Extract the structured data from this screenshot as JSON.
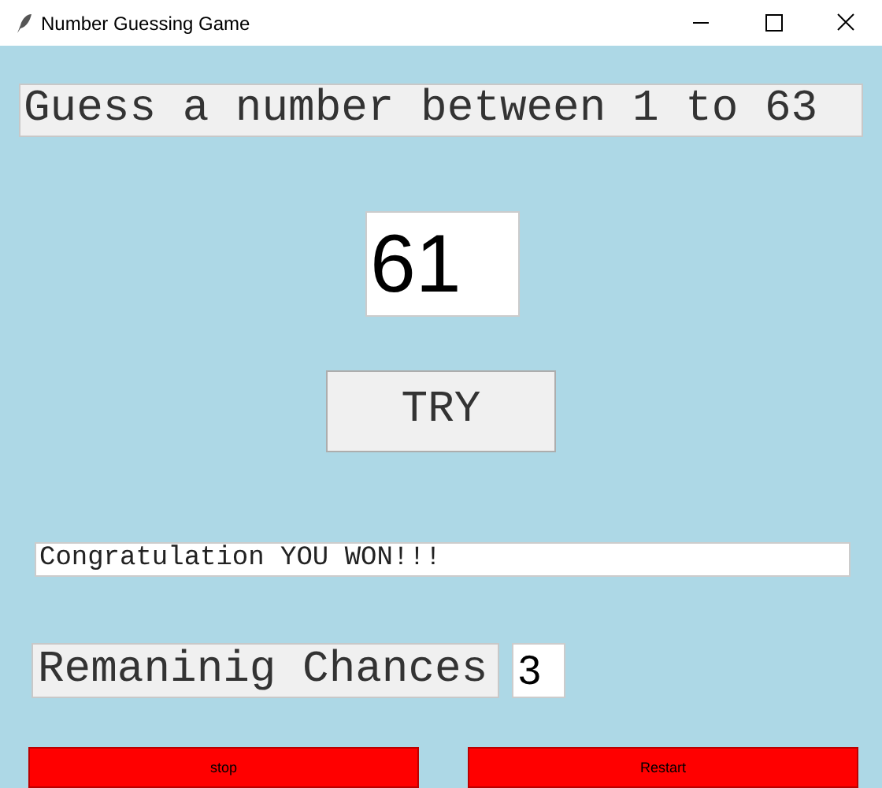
{
  "window": {
    "title": "Number Guessing Game"
  },
  "prompt": "Guess a number between 1 to 63",
  "guess_field": {
    "value": "61"
  },
  "try_button": "TRY",
  "result_field": {
    "value": "Congratulation YOU WON!!!"
  },
  "chances": {
    "label": "Remaninig Chances",
    "value": "3"
  },
  "buttons": [
    "stop",
    "Restart"
  ]
}
